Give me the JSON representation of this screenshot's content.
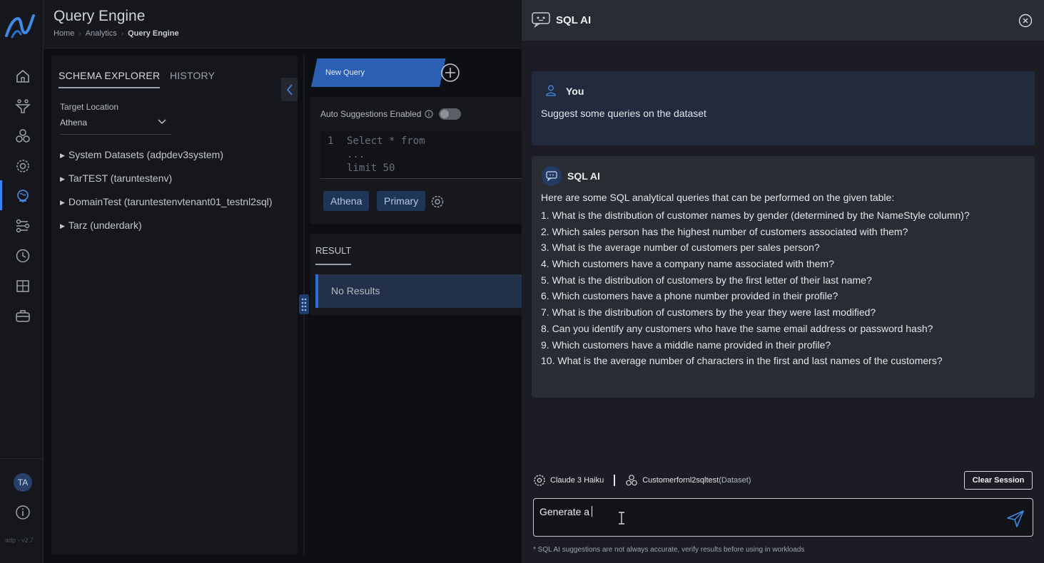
{
  "header": {
    "title": "Query Engine",
    "breadcrumbs": [
      "Home",
      "Analytics",
      "Query Engine"
    ]
  },
  "rail": {
    "nav_icons": [
      "home-icon",
      "funnel-icon",
      "nodes-icon",
      "settings-gear-icon",
      "globe-icon",
      "pipeline-icon",
      "clock-icon",
      "puzzle-icon",
      "briefcase-icon"
    ],
    "active": "globe-icon",
    "avatar_initials": "TA",
    "version": "adp - v2.7"
  },
  "schema_explorer": {
    "tabs": [
      "SCHEMA EXPLORER",
      "HISTORY"
    ],
    "target_location_label": "Target Location",
    "target_location_value": "Athena",
    "datasets": [
      "System Datasets (adpdev3system)",
      "TarTEST (taruntestenv)",
      "DomainTest (taruntestenvtenant01_testnl2sql)",
      "Tarz (underdark)"
    ]
  },
  "editor": {
    "tab_label": "New Query",
    "auto_suggestions_label": "Auto Suggestions Enabled",
    "auto_suggestions_enabled": false,
    "line_number": "1",
    "code_lines": [
      "Select * from",
      "...",
      "limit 50"
    ],
    "chips": [
      "Athena",
      "Primary"
    ]
  },
  "result": {
    "label": "RESULT",
    "empty_text": "No Results"
  },
  "ai_panel": {
    "title": "SQL AI",
    "user_name": "You",
    "user_message": "Suggest some queries on the dataset",
    "bot_name": "SQL AI",
    "bot_intro": "Here are some SQL analytical queries that can be performed on the given table:",
    "bot_items": [
      "1. What is the distribution of customer names by gender (determined by the NameStyle column)?",
      "2. Which sales person has the highest number of customers associated with them?",
      "3. What is the average number of customers per sales person?",
      "4. Which customers have a company name associated with them?",
      "5. What is the distribution of customers by the first letter of their last name?",
      "6. Which customers have a phone number provided in their profile?",
      "7. What is the distribution of customers by the year they were last modified?",
      "8. Can you identify any customers who have the same email address or password hash?",
      "9. Which customers have a middle name provided in their profile?",
      "10. What is the average number of characters in the first and last names of the customers?"
    ],
    "model": "Claude 3 Haiku",
    "dataset": "Customerfornl2sqltest",
    "dataset_suffix": "(Dataset)",
    "clear_label": "Clear Session",
    "input_value": "Generate a",
    "disclaimer": "* SQL AI suggestions are not always accurate, verify results before using in workloads"
  },
  "colors": {
    "accent": "#2b5fb4",
    "panel": "#1c1d24",
    "background": "#0e0f14"
  }
}
